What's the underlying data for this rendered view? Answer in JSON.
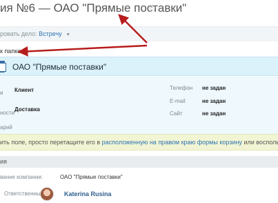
{
  "header": {
    "title": "ия №6 — ОАО \"Прямые поставки\"",
    "star_icon": "star-outline-icon"
  },
  "plan_row": {
    "label": "ровать дело:",
    "link": "Встречу",
    "caret": "▼"
  },
  "folder_link": "к папке",
  "company": {
    "name": "ОАО \"Прямые поставки\"",
    "icon": "company-card-icon"
  },
  "info": {
    "left_labels": [
      "и",
      "ности",
      "арий"
    ],
    "left_values": [
      "Клиент",
      "Доставка"
    ],
    "right": [
      {
        "label": "Телефон",
        "value": "не задан"
      },
      {
        "label": "E-mail",
        "value": "не задан"
      },
      {
        "label": "Сайт",
        "value": "не задан"
      }
    ]
  },
  "hint": {
    "before": "ить поле, просто перетащите его в",
    "link": "расположенную на правом краю формы корзину",
    "after": "или воспользуйтесь контекстным м"
  },
  "section": {
    "title": "ия"
  },
  "details": {
    "company_label": "вание компании:",
    "company_value": "ОАО \"Прямые поставки\"",
    "responsible_label": "Ответственный:",
    "responsible_name": "Katerina Rusina"
  },
  "colors": {
    "accent_blue": "#2f73b3",
    "header_bg": "#dcf2fb",
    "hint_bg": "#f2f5d4",
    "arrow_red": "#b71c1c"
  }
}
